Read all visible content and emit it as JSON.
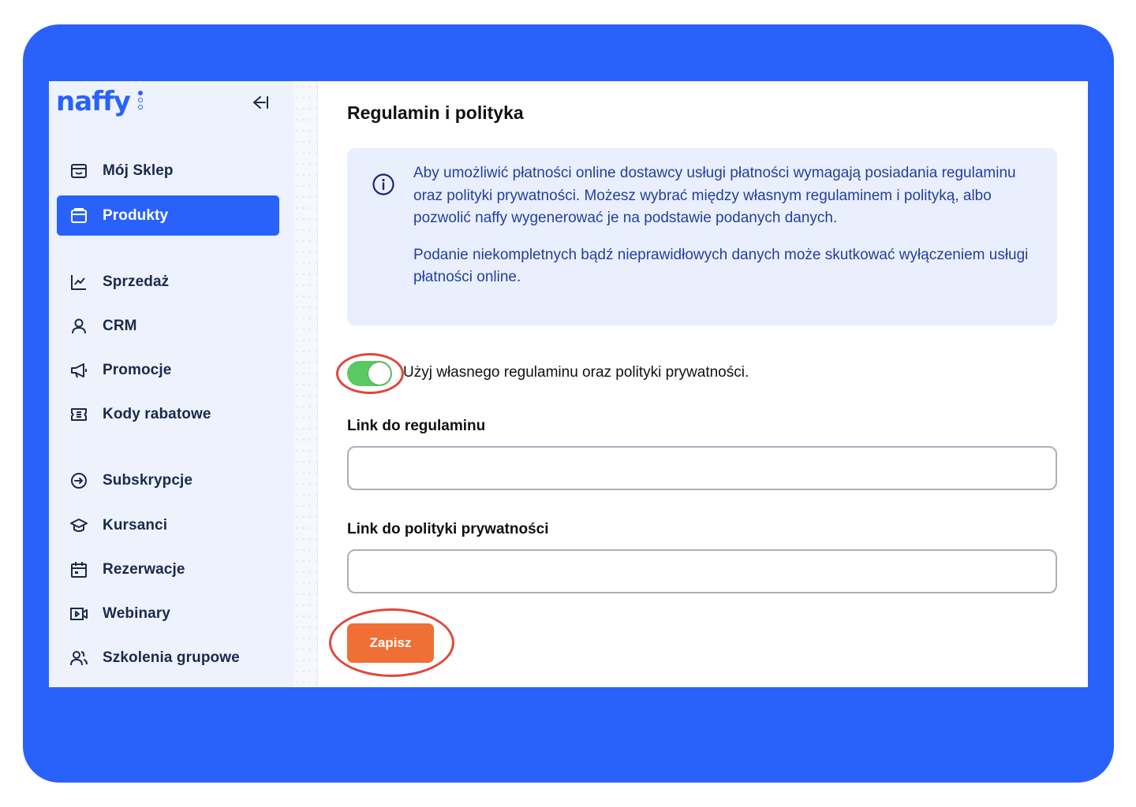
{
  "app": {
    "logo_text": "naffy",
    "brand_color": "#2962fb",
    "accent_color": "#ef6f35",
    "toggle_color": "#5ac964",
    "highlight_color": "#e0473a"
  },
  "sidebar": {
    "collapse_icon": "collapse-left-icon",
    "items": [
      {
        "label": "Mój Sklep",
        "icon": "store-icon",
        "active": false
      },
      {
        "label": "Produkty",
        "icon": "folder-icon",
        "active": true
      },
      {
        "label": "Sprzedaż",
        "icon": "chart-line-icon",
        "active": false
      },
      {
        "label": "CRM",
        "icon": "user-icon",
        "active": false
      },
      {
        "label": "Promocje",
        "icon": "megaphone-icon",
        "active": false
      },
      {
        "label": "Kody rabatowe",
        "icon": "ticket-icon",
        "active": false
      },
      {
        "label": "Subskrypcje",
        "icon": "subscription-icon",
        "active": false
      },
      {
        "label": "Kursanci",
        "icon": "graduation-cap-icon",
        "active": false
      },
      {
        "label": "Rezerwacje",
        "icon": "calendar-icon",
        "active": false
      },
      {
        "label": "Webinary",
        "icon": "video-icon",
        "active": false
      },
      {
        "label": "Szkolenia grupowe",
        "icon": "users-icon",
        "active": false
      }
    ]
  },
  "main": {
    "title": "Regulamin i polityka",
    "info": {
      "icon": "info-icon",
      "paragraph1": "Aby umożliwić płatności online dostawcy usługi płatności wymagają posiadania regulaminu oraz polityki prywatności. Możesz wybrać między własnym regulaminem i polityką, albo pozwolić naffy wygenerować je na podstawie podanych danych.",
      "paragraph2": "Podanie niekompletnych bądź nieprawidłowych danych może skutkować wyłączeniem usługi płatności online."
    },
    "toggle": {
      "label": "Użyj własnego regulaminu oraz polityki prywatności.",
      "checked": true
    },
    "fields": {
      "terms_label": "Link do regulaminu",
      "terms_value": "",
      "privacy_label": "Link do polityki prywatności",
      "privacy_value": ""
    },
    "save_label": "Zapisz"
  }
}
